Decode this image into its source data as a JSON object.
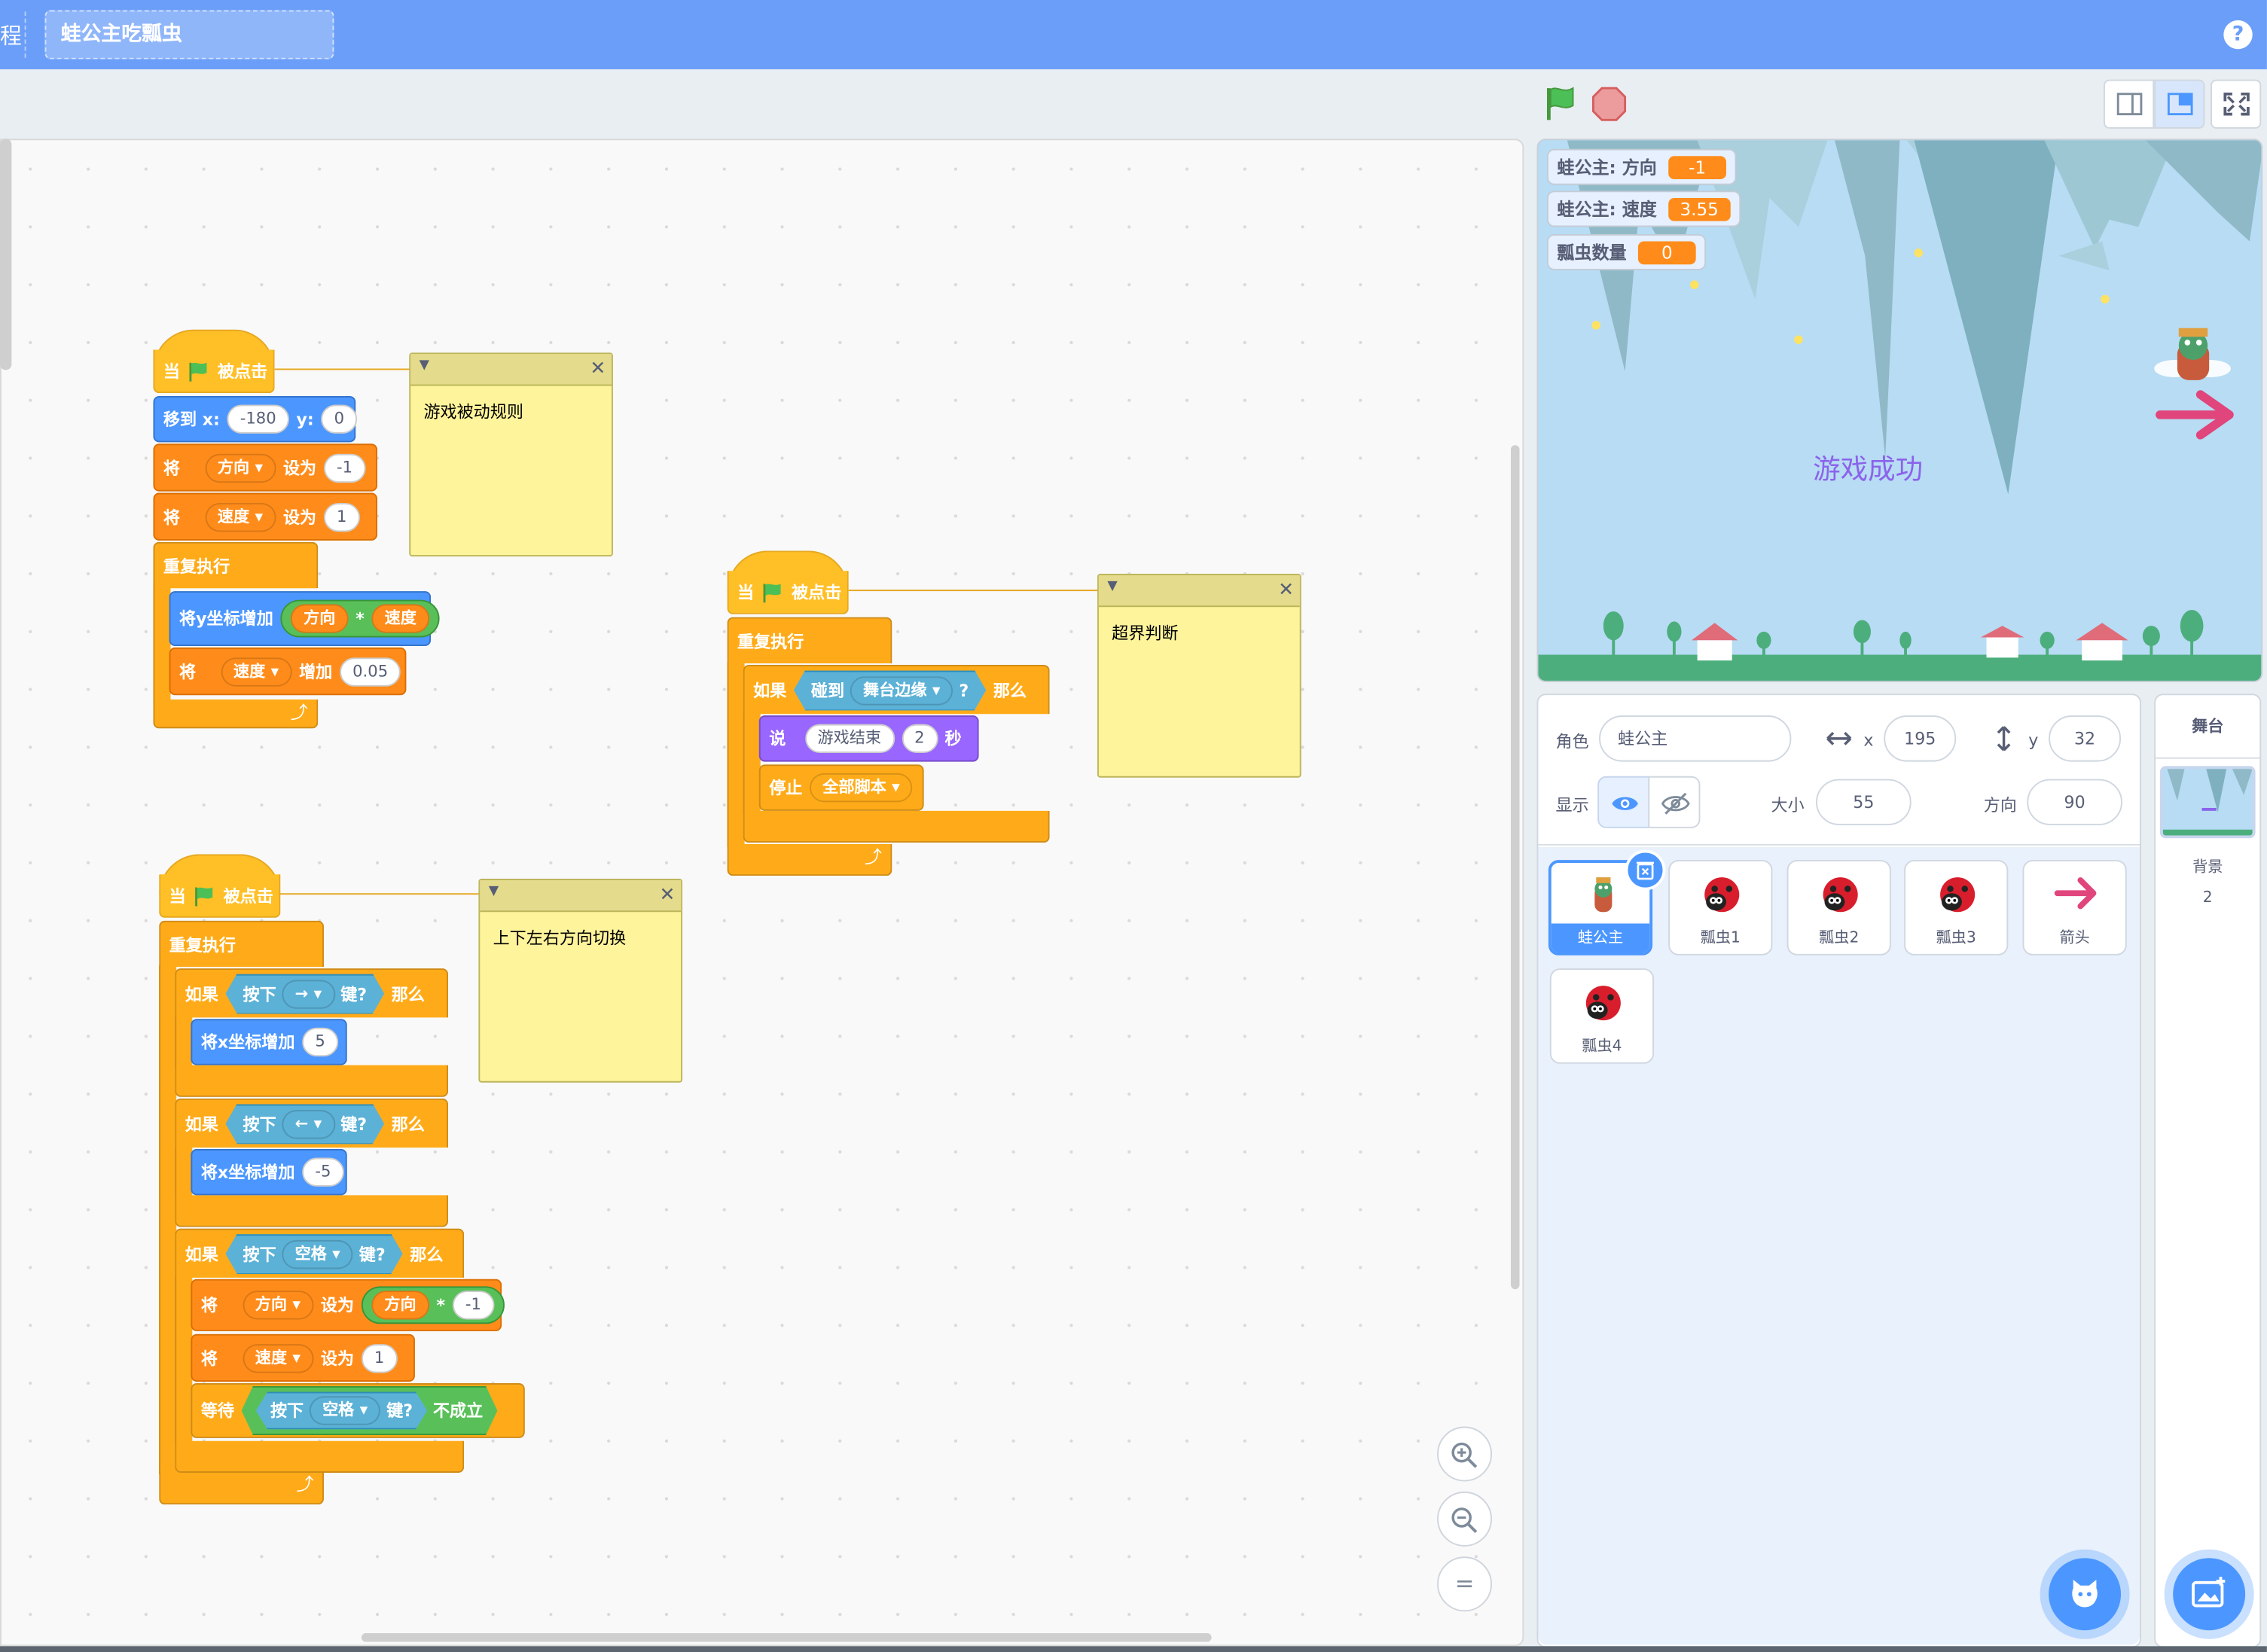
{
  "topbar": {
    "edge_glyph": "程",
    "project_title": "蛙公主吃瓢虫",
    "help": "?"
  },
  "scripts": {
    "s1": {
      "when": "当",
      "clicked": "被点击",
      "goto": "移到 x:",
      "goto_x": "-180",
      "goto_y_label": "y:",
      "goto_y": "0",
      "set": "将",
      "var_dir": "方向",
      "set_to": "设为",
      "dir_val": "-1",
      "var_speed": "速度",
      "speed_val": "1",
      "forever": "重复执行",
      "change_y": "将y坐标增加",
      "times": "*",
      "change_by": "增加",
      "change_val": "0.05"
    },
    "s2": {
      "when": "当",
      "clicked": "被点击",
      "forever": "重复执行",
      "if": "如果",
      "touching": "碰到",
      "edge": "舞台边缘",
      "q": "?",
      "then": "那么",
      "say": "说",
      "say_text": "游戏结束",
      "say_secs": "2",
      "secs": "秒",
      "stop": "停止",
      "stop_opt": "全部脚本"
    },
    "s3": {
      "when": "当",
      "clicked": "被点击",
      "forever": "重复执行",
      "if": "如果",
      "press": "按下",
      "key_right": "→",
      "key_left": "←",
      "key_space": "空格",
      "key_q": "键?",
      "then": "那么",
      "change_x": "将x坐标增加",
      "x_plus": "5",
      "x_minus": "-5",
      "set": "将",
      "var_dir": "方向",
      "set_to": "设为",
      "times": "*",
      "neg1": "-1",
      "var_speed": "速度",
      "one": "1",
      "wait": "等待",
      "not": "不成立"
    }
  },
  "comments": {
    "c1": "游戏被动规则",
    "c2": "超界判断",
    "c3": "上下左右方向切换"
  },
  "zoom": {
    "in": "+",
    "out": "−",
    "reset": "="
  },
  "stage": {
    "monitors": [
      {
        "label": "蛙公主: 方向",
        "value": "-1"
      },
      {
        "label": "蛙公主: 速度",
        "value": "3.55"
      },
      {
        "label": "瓢虫数量",
        "value": "0"
      }
    ],
    "success_text": "游戏成功"
  },
  "sprite_info": {
    "sprite_label": "角色",
    "sprite_name": "蛙公主",
    "x_label": "x",
    "x_value": "195",
    "y_label": "y",
    "y_value": "32",
    "show_label": "显示",
    "size_label": "大小",
    "size_value": "55",
    "direction_label": "方向",
    "direction_value": "90"
  },
  "sprites": [
    {
      "name": "蛙公主",
      "icon": "frog-princess-icon",
      "selected": true
    },
    {
      "name": "瓢虫1",
      "icon": "ladybug-icon"
    },
    {
      "name": "瓢虫2",
      "icon": "ladybug-icon"
    },
    {
      "name": "瓢虫3",
      "icon": "ladybug-icon"
    },
    {
      "name": "箭头",
      "icon": "arrow-icon"
    },
    {
      "name": "瓢虫4",
      "icon": "ladybug-icon"
    }
  ],
  "stage_side": {
    "title": "舞台",
    "backdrops_label": "背景",
    "backdrops_count": "2"
  },
  "colors": {
    "topbar": "#6b9ef8",
    "events": "#ffbf26",
    "motion": "#4c97ff",
    "variables": "#ff8c1a",
    "control": "#ffab19",
    "looks": "#9966ff",
    "sensing": "#5cb1d6",
    "operators": "#59c059",
    "comment": "#fef49c"
  }
}
